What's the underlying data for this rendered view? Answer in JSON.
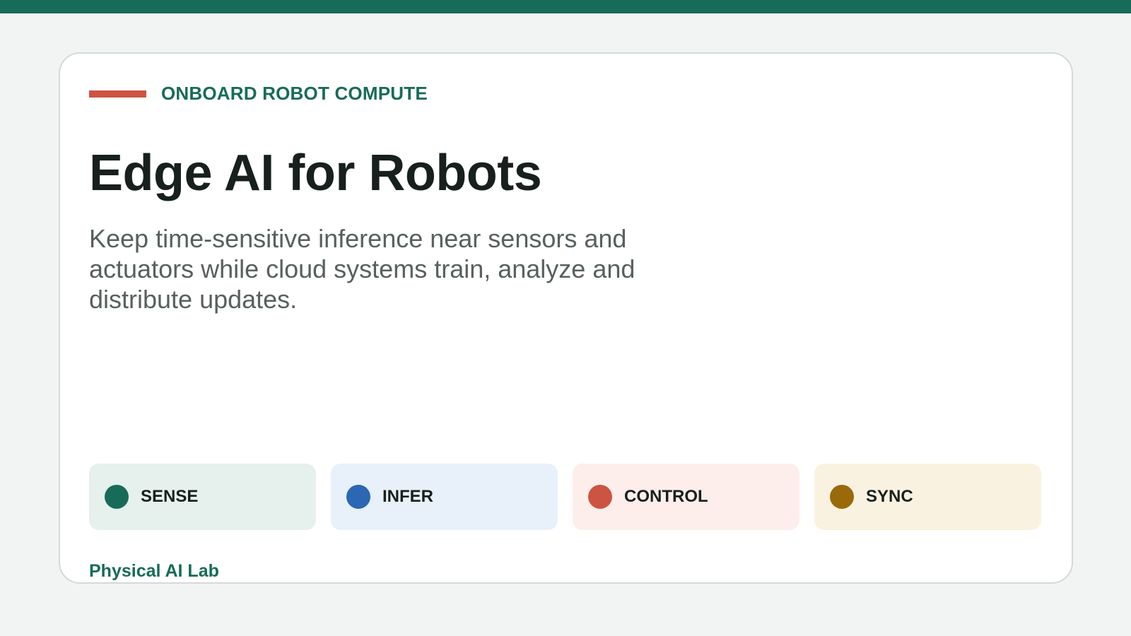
{
  "header": {
    "eyebrow": "ONBOARD ROBOT COMPUTE",
    "title": "Edge AI for Robots",
    "subtitle": "Keep time-sensitive inference near sensors and actuators while cloud systems train, analyze and distribute updates."
  },
  "stages": [
    {
      "label": "SENSE",
      "dot_color": "#186b59",
      "bg_color": "#e6f0ed"
    },
    {
      "label": "INFER",
      "dot_color": "#2b67b2",
      "bg_color": "#e8f0fa"
    },
    {
      "label": "CONTROL",
      "dot_color": "#cc5443",
      "bg_color": "#fdeeeb"
    },
    {
      "label": "SYNC",
      "dot_color": "#9a6a0a",
      "bg_color": "#faf2e0"
    }
  ],
  "footer": {
    "label": "Physical AI Lab"
  },
  "colors": {
    "accent": "#186b59",
    "highlight": "#cc5443",
    "background": "#f2f4f3"
  }
}
